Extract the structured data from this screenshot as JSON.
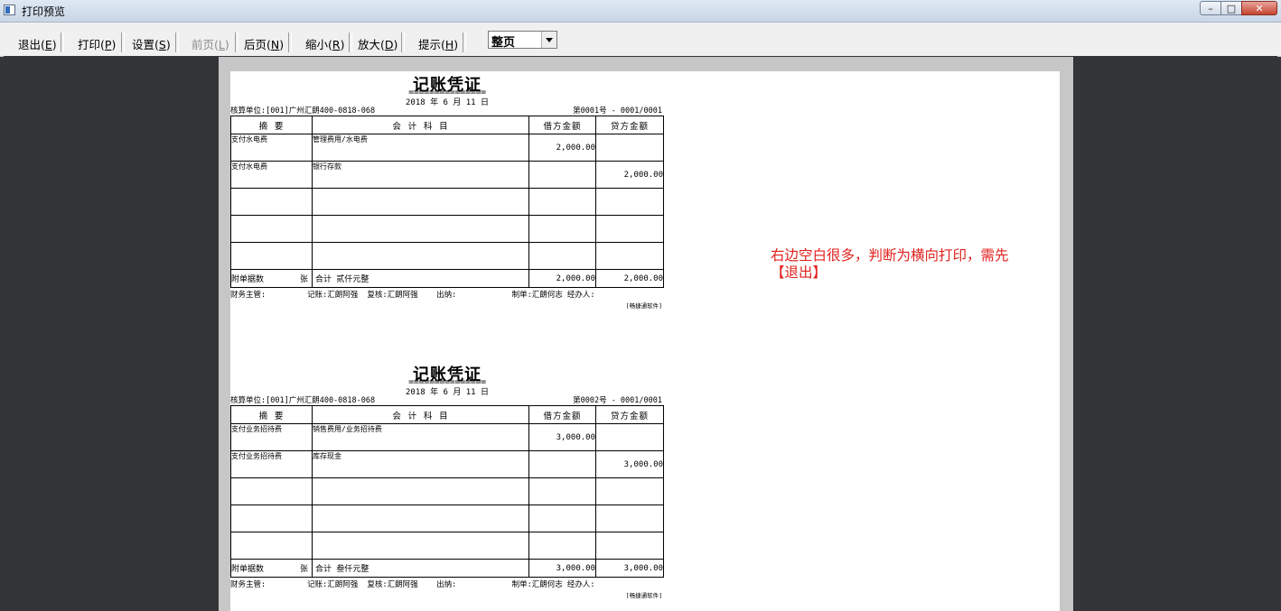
{
  "window": {
    "title": "打印预览"
  },
  "toolbar": {
    "exit": {
      "label": "退出(",
      "key": "E",
      "end": ")"
    },
    "print": {
      "label": "打印(",
      "key": "P",
      "end": ")"
    },
    "settings": {
      "label": "设置(",
      "key": "S",
      "end": ")"
    },
    "prev": {
      "label": "前页(",
      "key": "L",
      "end": ")"
    },
    "next": {
      "label": "后页(",
      "key": "N",
      "end": ")"
    },
    "zoom_out": {
      "label": "缩小(",
      "key": "R",
      "end": ")"
    },
    "zoom_in": {
      "label": "放大(",
      "key": "D",
      "end": ")"
    },
    "hint": {
      "label": "提示(",
      "key": "H",
      "end": ")"
    },
    "zoom_value": "整页"
  },
  "vouchers": [
    {
      "title": "记账凭证",
      "rule": "===============",
      "date": "2018 年  6  月 11 日",
      "unit": "核算单位:[001]广州汇朗400-0818-068",
      "number": "第0001号 - 0001/0001",
      "headers": [
        "摘  要",
        "会  计  科  目",
        "借方金额",
        "贷方金额"
      ],
      "rows": [
        [
          "支付水电费",
          "管理费用/水电费",
          "2,000.00",
          ""
        ],
        [
          "支付水电费",
          "银行存款",
          "",
          "2,000.00"
        ],
        [
          "",
          "",
          "",
          ""
        ],
        [
          "",
          "",
          "",
          ""
        ],
        [
          "",
          "",
          "",
          ""
        ]
      ],
      "attach": "附单据数",
      "attach_unit": "张",
      "total_label": "合计 贰仟元整",
      "total_debit": "2,000.00",
      "total_credit": "2,000.00",
      "signatures": "财务主管:         记账:汇朗阿强  复核:汇朗阿强    出纳:            制单:汇朗何志 经办人:",
      "footer": "[畅捷通软件]"
    },
    {
      "title": "记账凭证",
      "rule": "===============",
      "date": "2018 年  6  月 11 日",
      "unit": "核算单位:[001]广州汇朗400-0818-068",
      "number": "第0002号 - 0001/0001",
      "headers": [
        "摘  要",
        "会  计  科  目",
        "借方金额",
        "贷方金额"
      ],
      "rows": [
        [
          "支付业务招待费",
          "销售费用/业务招待费",
          "3,000.00",
          ""
        ],
        [
          "支付业务招待费",
          "库存现金",
          "",
          "3,000.00"
        ],
        [
          "",
          "",
          "",
          ""
        ],
        [
          "",
          "",
          "",
          ""
        ],
        [
          "",
          "",
          "",
          ""
        ]
      ],
      "attach": "附单据数",
      "attach_unit": "张",
      "total_label": "合计 叁仟元整",
      "total_debit": "3,000.00",
      "total_credit": "3,000.00",
      "signatures": "财务主管:         记账:汇朗阿强  复核:汇朗阿强    出纳:            制单:汇朗何志 经办人:",
      "footer": "[畅捷通软件]"
    }
  ],
  "annotation": {
    "line1": "右边空白很多，判断为横向打印，需先",
    "line2": "【退出】",
    "color": "#e0211d"
  }
}
